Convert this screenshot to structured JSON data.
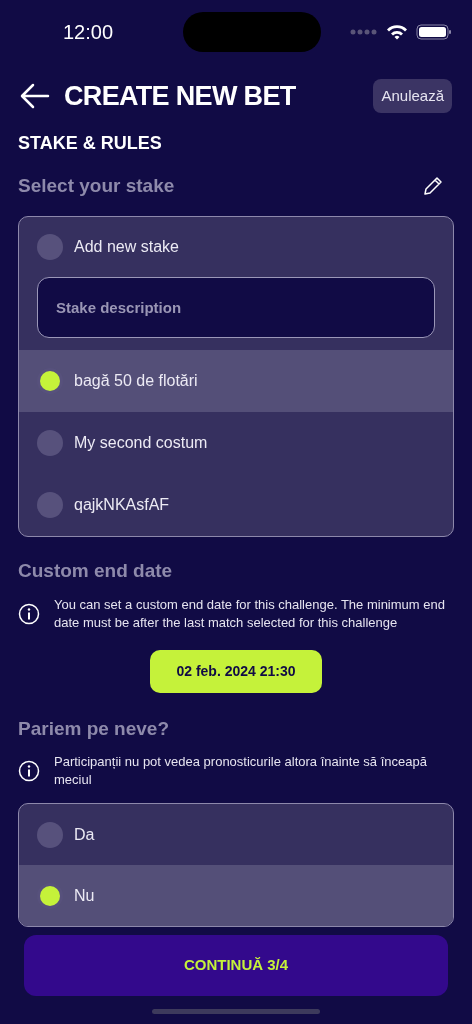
{
  "status_bar": {
    "time": "12:00"
  },
  "header": {
    "title": "CREATE NEW BET",
    "cancel": "Anulează"
  },
  "section_title": "STAKE & RULES",
  "stake": {
    "title": "Select your stake",
    "options": [
      {
        "kind": "new",
        "label": "Add new stake",
        "placeholder": "Stake description",
        "selected": false
      },
      {
        "kind": "option",
        "label": "bagă 50 de flotări",
        "selected": true
      },
      {
        "kind": "option",
        "label": "My second costum",
        "selected": false
      },
      {
        "kind": "option",
        "label": "qajkNKAsfAF",
        "selected": false
      }
    ]
  },
  "end_date": {
    "title": "Custom end date",
    "info": "You can set a custom end date for this challenge. The minimum end date must be after the last match selected for this challenge",
    "date": "02 feb. 2024 21:30"
  },
  "blind": {
    "title": "Pariem pe neve?",
    "info": "Participanții nu pot vedea pronosticurile altora înainte să înceapă meciul",
    "options": [
      {
        "label": "Da",
        "selected": false
      },
      {
        "label": "Nu",
        "selected": true
      }
    ]
  },
  "continue": "CONTINUĂ 3/4"
}
